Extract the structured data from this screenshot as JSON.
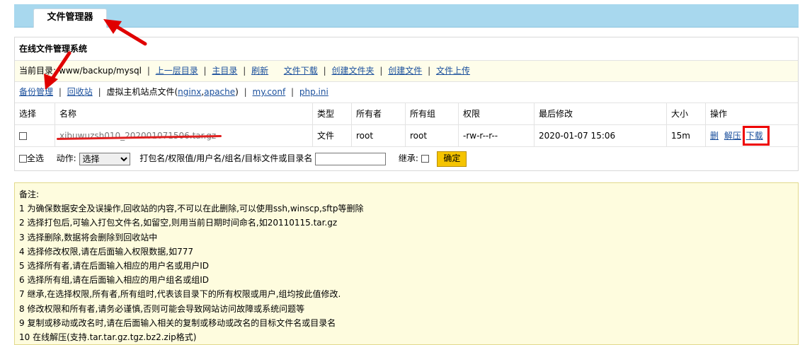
{
  "tab": {
    "label": "文件管理器"
  },
  "panel": {
    "title": "在线文件管理系统"
  },
  "path_bar": {
    "prefix": "当前目录:",
    "path": "/www/backup/mysql",
    "links": [
      "上一层目录",
      "主目录",
      "刷新",
      "文件下载",
      "创建文件夹",
      "创建文件",
      "文件上传"
    ]
  },
  "backup_bar": {
    "backup": "备份管理",
    "recycle": "回收站",
    "vhost_text": "虚拟主机站点文件(",
    "nginx": "nginx",
    "comma": ",",
    "apache": "apache",
    "close": ")",
    "myconf": "my.conf",
    "phpini": "php.ini"
  },
  "table": {
    "headers": [
      "选择",
      "名称",
      "类型",
      "所有者",
      "所有组",
      "权限",
      "最后修改",
      "大小",
      "操作"
    ],
    "row": {
      "name": "xibuwuzsh010_202001071506.tar.gz",
      "type": "文件",
      "owner": "root",
      "group": "root",
      "perm": "-rw-r--r--",
      "modified": "2020-01-07 15:06",
      "size": "15m",
      "ops": [
        "删",
        "解压",
        "下载"
      ]
    }
  },
  "actions": {
    "select_all": "全选",
    "action_label": "动作:",
    "action_value": "选择",
    "pack_label": "打包名/权限值/用户名/组名/目标文件或目录名",
    "inherit_label": "继承:",
    "confirm": "确定"
  },
  "notes": {
    "title": "备注:",
    "lines": [
      "1 为确保数据安全及误操作,回收站的内容,不可以在此删除,可以使用ssh,winscp,sftp等删除",
      "2 选择打包后,可输入打包文件名,如留空,则用当前日期时间命名,如20110115.tar.gz",
      "3 选择删除,数据将会删除到回收站中",
      "4 选择修改权限,请在后面输入权限数据,如777",
      "5 选择所有者,请在后面输入相应的用户名或用户ID",
      "6 选择所有组,请在后面输入相应的用户组名或组ID",
      "7 继承,在选择权限,所有者,所有组时,代表该目录下的所有权限或用户,组均按此值修改.",
      "8 修改权限和所有者,请务必谨慎,否则可能会导致网站访问故障或系统问题等",
      "9 复制或移动或改名时,请在后面输入相关的复制或移动或改名的目标文件名或目录名",
      "10 在线解压(支持.tar.tar.gz.tgz.bz2.zip格式)"
    ]
  },
  "colors": {
    "header": "#a8d8ee",
    "highlight": "#fefdea",
    "annotation": "#e00000",
    "button": "#f5c400"
  }
}
